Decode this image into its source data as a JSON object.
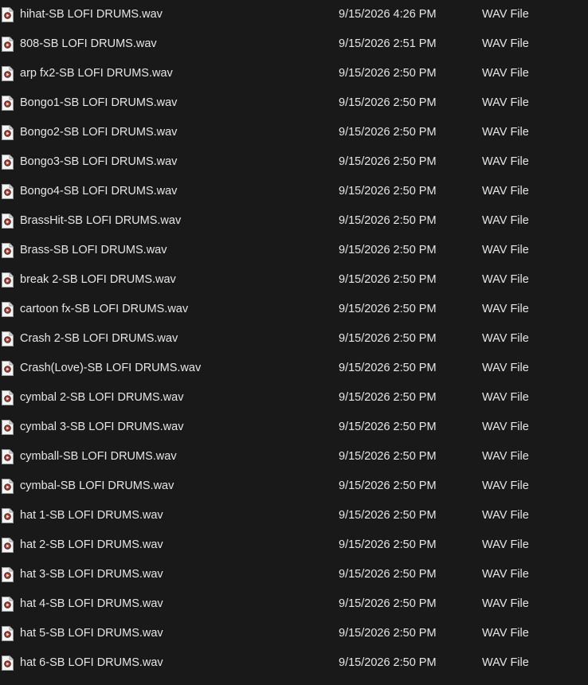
{
  "files": [
    {
      "name": " hihat-SB LOFI DRUMS.wav",
      "date": "9/15/2026 4:26 PM",
      "type": "WAV File"
    },
    {
      "name": "808-SB LOFI DRUMS.wav",
      "date": "9/15/2026 2:51 PM",
      "type": "WAV File"
    },
    {
      "name": "arp fx2-SB LOFI DRUMS.wav",
      "date": "9/15/2026 2:50 PM",
      "type": "WAV File"
    },
    {
      "name": "Bongo1-SB LOFI DRUMS.wav",
      "date": "9/15/2026 2:50 PM",
      "type": "WAV File"
    },
    {
      "name": "Bongo2-SB LOFI DRUMS.wav",
      "date": "9/15/2026 2:50 PM",
      "type": "WAV File"
    },
    {
      "name": "Bongo3-SB LOFI DRUMS.wav",
      "date": "9/15/2026 2:50 PM",
      "type": "WAV File"
    },
    {
      "name": "Bongo4-SB LOFI DRUMS.wav",
      "date": "9/15/2026 2:50 PM",
      "type": "WAV File"
    },
    {
      "name": "BrassHit-SB LOFI DRUMS.wav",
      "date": "9/15/2026 2:50 PM",
      "type": "WAV File"
    },
    {
      "name": "Brass-SB LOFI DRUMS.wav",
      "date": "9/15/2026 2:50 PM",
      "type": "WAV File"
    },
    {
      "name": "break 2-SB LOFI DRUMS.wav",
      "date": "9/15/2026 2:50 PM",
      "type": "WAV File"
    },
    {
      "name": "cartoon fx-SB LOFI DRUMS.wav",
      "date": "9/15/2026 2:50 PM",
      "type": "WAV File"
    },
    {
      "name": "Crash 2-SB LOFI DRUMS.wav",
      "date": "9/15/2026 2:50 PM",
      "type": "WAV File"
    },
    {
      "name": "Crash(Love)-SB LOFI DRUMS.wav",
      "date": "9/15/2026 2:50 PM",
      "type": "WAV File"
    },
    {
      "name": "cymbal 2-SB LOFI DRUMS.wav",
      "date": "9/15/2026 2:50 PM",
      "type": "WAV File"
    },
    {
      "name": "cymbal 3-SB LOFI DRUMS.wav",
      "date": "9/15/2026 2:50 PM",
      "type": "WAV File"
    },
    {
      "name": "cymball-SB LOFI DRUMS.wav",
      "date": "9/15/2026 2:50 PM",
      "type": "WAV File"
    },
    {
      "name": "cymbal-SB LOFI DRUMS.wav",
      "date": "9/15/2026 2:50 PM",
      "type": "WAV File"
    },
    {
      "name": "hat 1-SB LOFI DRUMS.wav",
      "date": "9/15/2026 2:50 PM",
      "type": "WAV File"
    },
    {
      "name": "hat 2-SB LOFI DRUMS.wav",
      "date": "9/15/2026 2:50 PM",
      "type": "WAV File"
    },
    {
      "name": "hat 3-SB LOFI DRUMS.wav",
      "date": "9/15/2026 2:50 PM",
      "type": "WAV File"
    },
    {
      "name": "hat 4-SB LOFI DRUMS.wav",
      "date": "9/15/2026 2:50 PM",
      "type": "WAV File"
    },
    {
      "name": "hat 5-SB LOFI DRUMS.wav",
      "date": "9/15/2026 2:50 PM",
      "type": "WAV File"
    },
    {
      "name": "hat 6-SB LOFI DRUMS.wav",
      "date": "9/15/2026 2:50 PM",
      "type": "WAV File"
    }
  ],
  "icon": "wav-file-icon",
  "colors": {
    "background": "#191919",
    "text": "#e6e6e6",
    "icon_page": "#f4f4f4",
    "icon_accent": "#c0392b"
  }
}
